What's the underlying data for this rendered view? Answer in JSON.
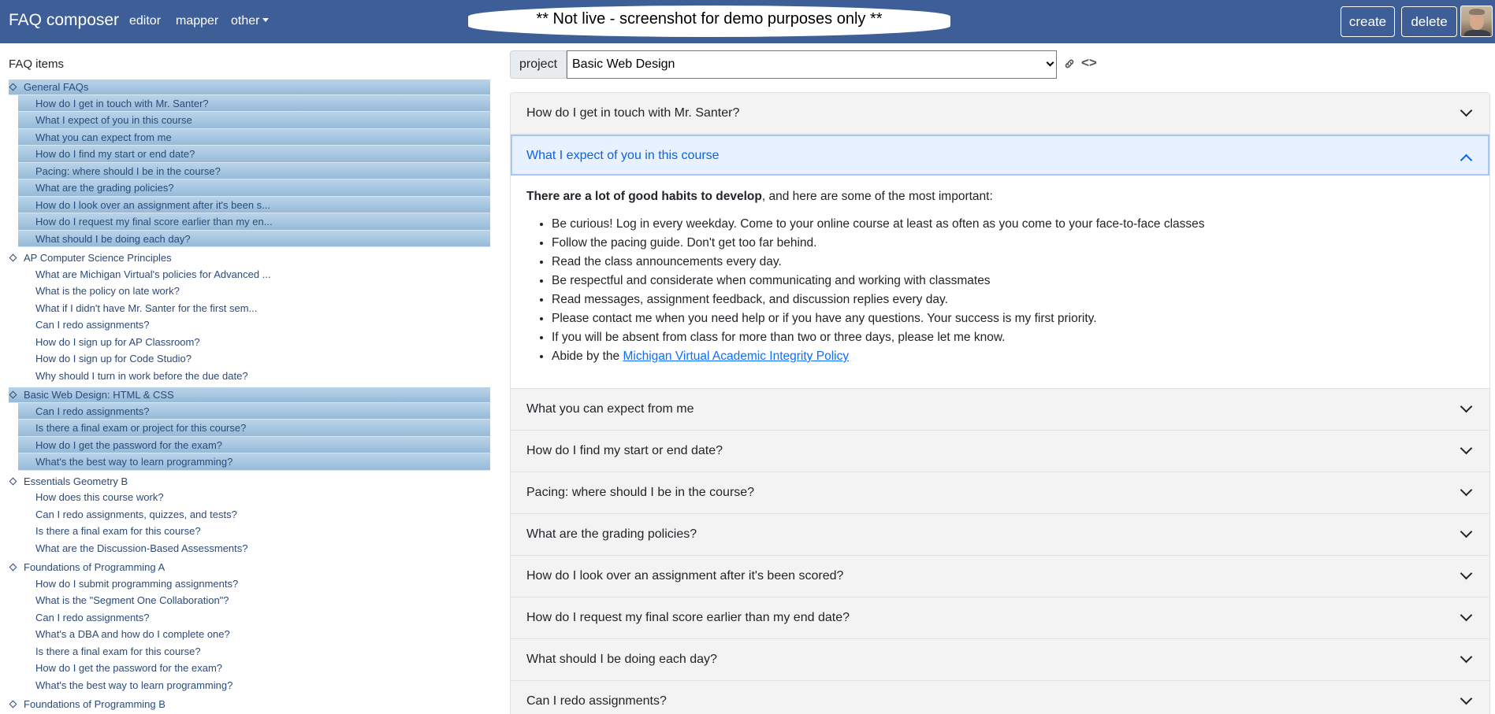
{
  "navbar": {
    "brand": "FAQ composer",
    "links": [
      "editor",
      "mapper",
      "other"
    ],
    "banner": "** Not live - screenshot for demo purposes only **",
    "create_label": "create",
    "delete_label": "delete"
  },
  "sidebar": {
    "title": "FAQ items",
    "groups": [
      {
        "title": "General FAQs",
        "items": [
          "How do I get in touch with Mr. Santer?",
          "What I expect of you in this course",
          "What you can expect from me",
          "How do I find my start or end date?",
          "Pacing: where should I be in the course?",
          "What are the grading policies?",
          "How do I look over an assignment after it's been s...",
          "How do I request my final score earlier than my en...",
          "What should I be doing each day?"
        ]
      },
      {
        "title": "AP Computer Science Principles",
        "items": [
          "What are Michigan Virtual's policies for Advanced ...",
          "What is the policy on late work?",
          "What if I didn't have Mr. Santer for the first sem...",
          "Can I redo assignments?",
          "How do I sign up for AP Classroom?",
          "How do I sign up for Code Studio?",
          "Why should I turn in work before the due date?"
        ]
      },
      {
        "title": "Basic Web Design: HTML & CSS",
        "items": [
          "Can I redo assignments?",
          "Is there a final exam or project for this course?",
          "How do I get the password for the exam?",
          "What's the best way to learn programming?"
        ]
      },
      {
        "title": "Essentials Geometry B",
        "items": [
          "How does this course work?",
          "Can I redo assignments, quizzes, and tests?",
          "Is there a final exam for this course?",
          "What are the Discussion-Based Assessments?"
        ]
      },
      {
        "title": "Foundations of Programming A",
        "items": [
          "How do I submit programming assignments?",
          "What is the \"Segment One Collaboration\"?",
          "Can I redo assignments?",
          "What's a DBA and how do I complete one?",
          "Is there a final exam for this course?",
          "How do I get the password for the exam?",
          "What's the best way to learn programming?"
        ]
      },
      {
        "title": "Foundations of Programming B",
        "items": []
      }
    ]
  },
  "project": {
    "label": "project",
    "selected": "Basic Web Design",
    "code_icon_text": "<>"
  },
  "accordion": {
    "items": [
      "How do I get in touch with Mr. Santer?",
      "What I expect of you in this course",
      "What you can expect from me",
      "How do I find my start or end date?",
      "Pacing: where should I be in the course?",
      "What are the grading policies?",
      "How do I look over an assignment after it's been scored?",
      "How do I request my final score earlier than my end date?",
      "What should I be doing each day?",
      "Can I redo assignments?"
    ],
    "expanded_body": {
      "intro_bold": "There are a lot of good habits to develop",
      "intro_rest": ", and here are some of the most important:",
      "bullets": [
        "Be curious!  Log in every weekday.  Come to your online course at least as often as you come to your face-to-face classes",
        "Follow the pacing guide.  Don't get too far behind.",
        "Read the class announcements every day.",
        "Be respectful and considerate when communicating and working with classmates",
        "Read messages, assignment feedback, and discussion replies every day.",
        "Please contact me when you need help or if you have any questions.  Your success is my first priority.",
        "If you will be absent from class for more than two or three days, please let me know."
      ],
      "last_bullet_prefix": "Abide by the ",
      "last_bullet_link": "Michigan Virtual Academic Integrity Policy"
    }
  },
  "colors": {
    "navbar": "#3d5e96",
    "highlight": "#a9c9e4",
    "active_header_bg": "#e7f1ff",
    "active_header_text": "#0c63e4",
    "link": "#0d6efd"
  }
}
